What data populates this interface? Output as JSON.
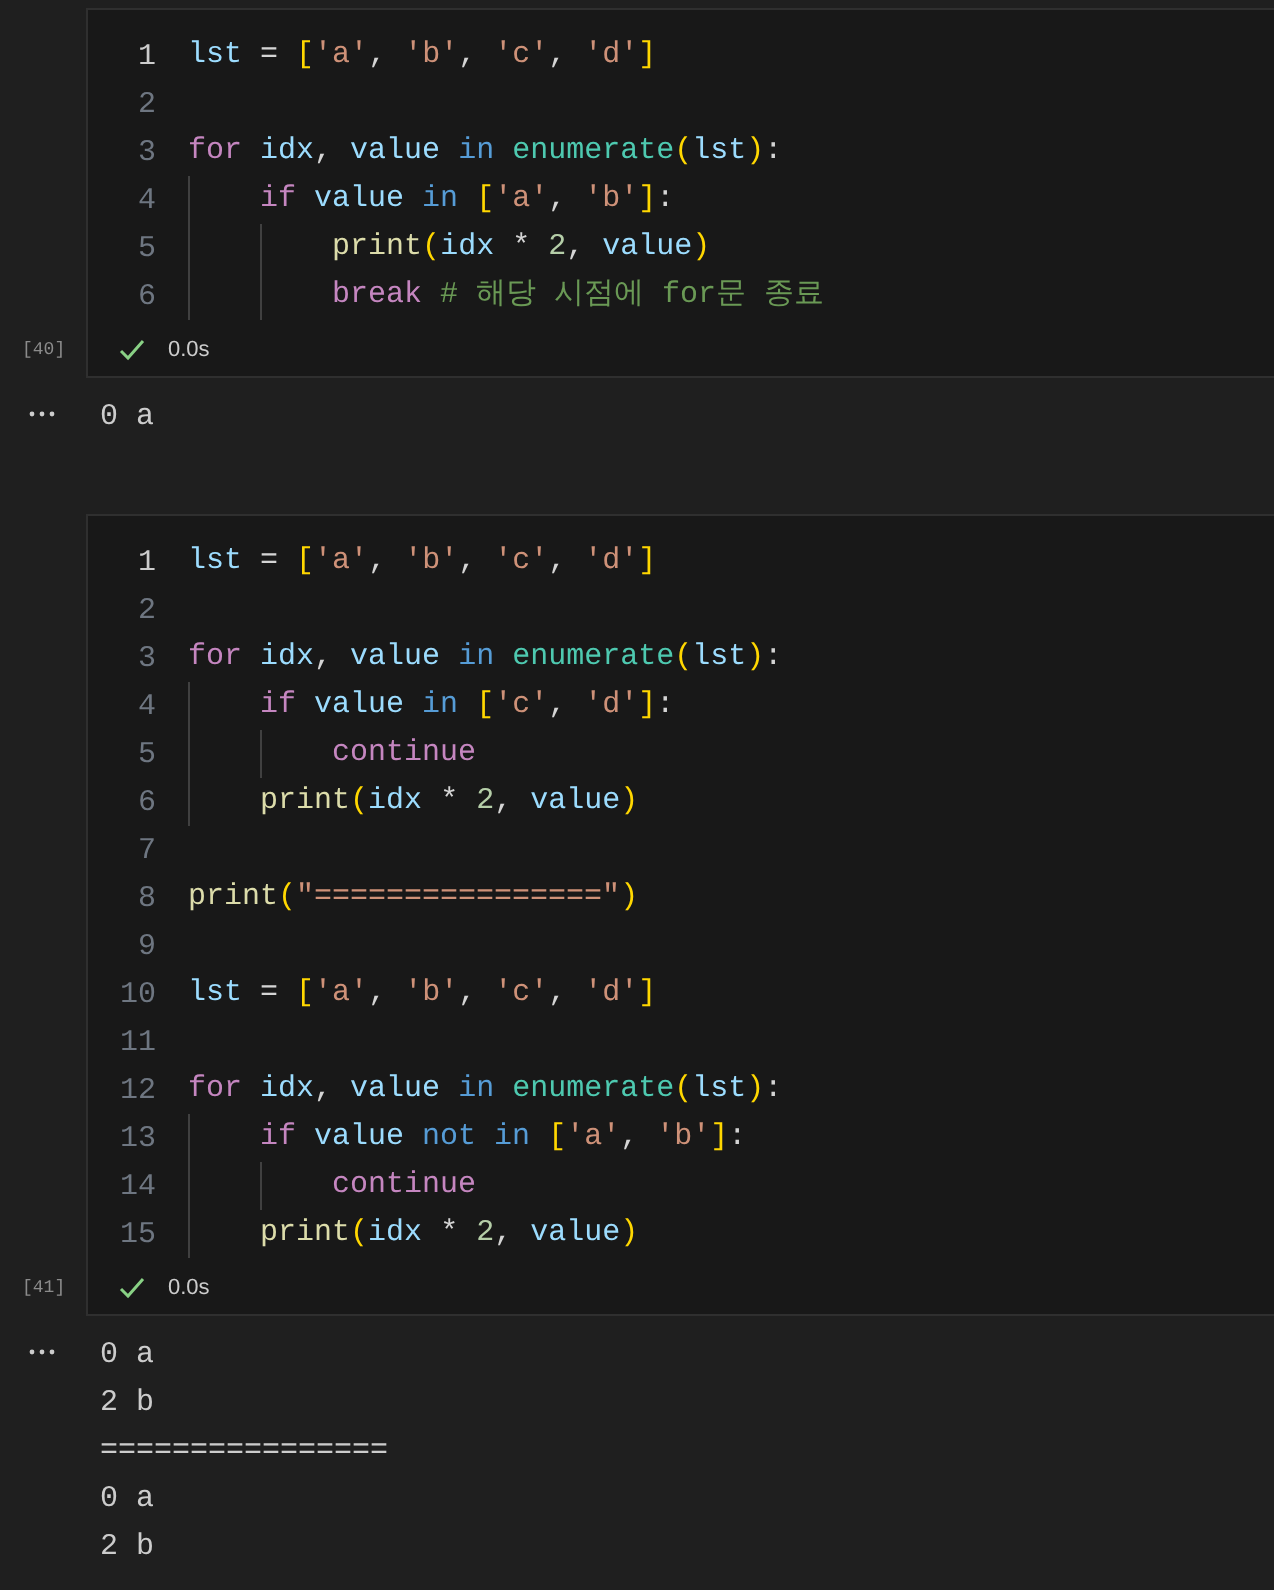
{
  "cells": [
    {
      "execution_count": "[40]",
      "status": "0.0s",
      "succeeded": true,
      "lines": [
        {
          "number": "1",
          "active": true,
          "tokens": [
            {
              "text": "lst ",
              "kind": "var"
            },
            {
              "text": "= ",
              "kind": "op"
            },
            {
              "text": "[",
              "kind": "bracket"
            },
            {
              "text": "'a'",
              "kind": "string"
            },
            {
              "text": ", ",
              "kind": "op"
            },
            {
              "text": "'b'",
              "kind": "string"
            },
            {
              "text": ", ",
              "kind": "op"
            },
            {
              "text": "'c'",
              "kind": "string"
            },
            {
              "text": ", ",
              "kind": "op"
            },
            {
              "text": "'d'",
              "kind": "string"
            },
            {
              "text": "]",
              "kind": "bracket"
            }
          ]
        },
        {
          "number": "2",
          "active": false
        },
        {
          "number": "3",
          "active": false,
          "tokens": [
            {
              "text": "for ",
              "kind": "control"
            },
            {
              "text": "idx",
              "kind": "var"
            },
            {
              "text": ", ",
              "kind": "op"
            },
            {
              "text": "value ",
              "kind": "var"
            },
            {
              "text": "in ",
              "kind": "keyword"
            },
            {
              "text": "enumerate",
              "kind": "builtin"
            },
            {
              "text": "(",
              "kind": "bracket"
            },
            {
              "text": "lst",
              "kind": "var"
            },
            {
              "text": ")",
              "kind": "bracket"
            },
            {
              "text": ":",
              "kind": "op"
            }
          ]
        },
        {
          "number": "4",
          "active": false,
          "tokens": [
            {
              "text": "    if ",
              "kind": "control"
            },
            {
              "text": "value ",
              "kind": "var"
            },
            {
              "text": "in ",
              "kind": "keyword"
            },
            {
              "text": "[",
              "kind": "bracket"
            },
            {
              "text": "'a'",
              "kind": "string"
            },
            {
              "text": ", ",
              "kind": "op"
            },
            {
              "text": "'b'",
              "kind": "string"
            },
            {
              "text": "]",
              "kind": "bracket"
            },
            {
              "text": ":",
              "kind": "op"
            }
          ]
        },
        {
          "number": "5",
          "active": false,
          "tokens": [
            {
              "text": "        print",
              "kind": "function"
            },
            {
              "text": "(",
              "kind": "bracket"
            },
            {
              "text": "idx",
              "kind": "var"
            },
            {
              "text": " * ",
              "kind": "op"
            },
            {
              "text": "2",
              "kind": "number"
            },
            {
              "text": ", ",
              "kind": "op"
            },
            {
              "text": "value",
              "kind": "var"
            },
            {
              "text": ")",
              "kind": "bracket"
            }
          ]
        },
        {
          "number": "6",
          "active": false,
          "tokens": [
            {
              "text": "        break ",
              "kind": "control"
            },
            {
              "text": "# 해당 시점에 for문 종료",
              "kind": "comment"
            }
          ]
        }
      ],
      "output": [
        "0 a"
      ]
    },
    {
      "execution_count": "[41]",
      "status": "0.0s",
      "succeeded": true,
      "lines": [
        {
          "number": "1",
          "active": true,
          "tokens": [
            {
              "text": "lst ",
              "kind": "var"
            },
            {
              "text": "= ",
              "kind": "op"
            },
            {
              "text": "[",
              "kind": "bracket"
            },
            {
              "text": "'a'",
              "kind": "string"
            },
            {
              "text": ", ",
              "kind": "op"
            },
            {
              "text": "'b'",
              "kind": "string"
            },
            {
              "text": ", ",
              "kind": "op"
            },
            {
              "text": "'c'",
              "kind": "string"
            },
            {
              "text": ", ",
              "kind": "op"
            },
            {
              "text": "'d'",
              "kind": "string"
            },
            {
              "text": "]",
              "kind": "bracket"
            }
          ]
        },
        {
          "number": "2",
          "active": false
        },
        {
          "number": "3",
          "active": false,
          "tokens": [
            {
              "text": "for ",
              "kind": "control"
            },
            {
              "text": "idx",
              "kind": "var"
            },
            {
              "text": ", ",
              "kind": "op"
            },
            {
              "text": "value ",
              "kind": "var"
            },
            {
              "text": "in ",
              "kind": "keyword"
            },
            {
              "text": "enumerate",
              "kind": "builtin"
            },
            {
              "text": "(",
              "kind": "bracket"
            },
            {
              "text": "lst",
              "kind": "var"
            },
            {
              "text": ")",
              "kind": "bracket"
            },
            {
              "text": ":",
              "kind": "op"
            }
          ]
        },
        {
          "number": "4",
          "active": false,
          "tokens": [
            {
              "text": "    if ",
              "kind": "control"
            },
            {
              "text": "value ",
              "kind": "var"
            },
            {
              "text": "in ",
              "kind": "keyword"
            },
            {
              "text": "[",
              "kind": "bracket"
            },
            {
              "text": "'c'",
              "kind": "string"
            },
            {
              "text": ", ",
              "kind": "op"
            },
            {
              "text": "'d'",
              "kind": "string"
            },
            {
              "text": "]",
              "kind": "bracket"
            },
            {
              "text": ":",
              "kind": "op"
            }
          ]
        },
        {
          "number": "5",
          "active": false,
          "tokens": [
            {
              "text": "        continue",
              "kind": "control"
            }
          ]
        },
        {
          "number": "6",
          "active": false,
          "tokens": [
            {
              "text": "    print",
              "kind": "function"
            },
            {
              "text": "(",
              "kind": "bracket"
            },
            {
              "text": "idx",
              "kind": "var"
            },
            {
              "text": " * ",
              "kind": "op"
            },
            {
              "text": "2",
              "kind": "number"
            },
            {
              "text": ", ",
              "kind": "op"
            },
            {
              "text": "value",
              "kind": "var"
            },
            {
              "text": ")",
              "kind": "bracket"
            }
          ]
        },
        {
          "number": "7",
          "active": false
        },
        {
          "number": "8",
          "active": false,
          "tokens": [
            {
              "text": "print",
              "kind": "function"
            },
            {
              "text": "(",
              "kind": "bracket"
            },
            {
              "text": "\"================\"",
              "kind": "string"
            },
            {
              "text": ")",
              "kind": "bracket"
            }
          ]
        },
        {
          "number": "9",
          "active": false
        },
        {
          "number": "10",
          "active": false,
          "tokens": [
            {
              "text": "lst ",
              "kind": "var"
            },
            {
              "text": "= ",
              "kind": "op"
            },
            {
              "text": "[",
              "kind": "bracket"
            },
            {
              "text": "'a'",
              "kind": "string"
            },
            {
              "text": ", ",
              "kind": "op"
            },
            {
              "text": "'b'",
              "kind": "string"
            },
            {
              "text": ", ",
              "kind": "op"
            },
            {
              "text": "'c'",
              "kind": "string"
            },
            {
              "text": ", ",
              "kind": "op"
            },
            {
              "text": "'d'",
              "kind": "string"
            },
            {
              "text": "]",
              "kind": "bracket"
            }
          ]
        },
        {
          "number": "11",
          "active": false
        },
        {
          "number": "12",
          "active": false,
          "tokens": [
            {
              "text": "for ",
              "kind": "control"
            },
            {
              "text": "idx",
              "kind": "var"
            },
            {
              "text": ", ",
              "kind": "op"
            },
            {
              "text": "value ",
              "kind": "var"
            },
            {
              "text": "in ",
              "kind": "keyword"
            },
            {
              "text": "enumerate",
              "kind": "builtin"
            },
            {
              "text": "(",
              "kind": "bracket"
            },
            {
              "text": "lst",
              "kind": "var"
            },
            {
              "text": ")",
              "kind": "bracket"
            },
            {
              "text": ":",
              "kind": "op"
            }
          ]
        },
        {
          "number": "13",
          "active": false,
          "tokens": [
            {
              "text": "    if ",
              "kind": "control"
            },
            {
              "text": "value ",
              "kind": "var"
            },
            {
              "text": "not in ",
              "kind": "keyword"
            },
            {
              "text": "[",
              "kind": "bracket"
            },
            {
              "text": "'a'",
              "kind": "string"
            },
            {
              "text": ", ",
              "kind": "op"
            },
            {
              "text": "'b'",
              "kind": "string"
            },
            {
              "text": "]",
              "kind": "bracket"
            },
            {
              "text": ":",
              "kind": "op"
            }
          ]
        },
        {
          "number": "14",
          "active": false,
          "tokens": [
            {
              "text": "        continue",
              "kind": "control"
            }
          ]
        },
        {
          "number": "15",
          "active": false,
          "tokens": [
            {
              "text": "    print",
              "kind": "function"
            },
            {
              "text": "(",
              "kind": "bracket"
            },
            {
              "text": "idx",
              "kind": "var"
            },
            {
              "text": " * ",
              "kind": "op"
            },
            {
              "text": "2",
              "kind": "number"
            },
            {
              "text": ", ",
              "kind": "op"
            },
            {
              "text": "value",
              "kind": "var"
            },
            {
              "text": ")",
              "kind": "bracket"
            }
          ]
        }
      ],
      "output": [
        "0 a",
        "2 b",
        "================",
        "0 a",
        "2 b"
      ]
    }
  ]
}
